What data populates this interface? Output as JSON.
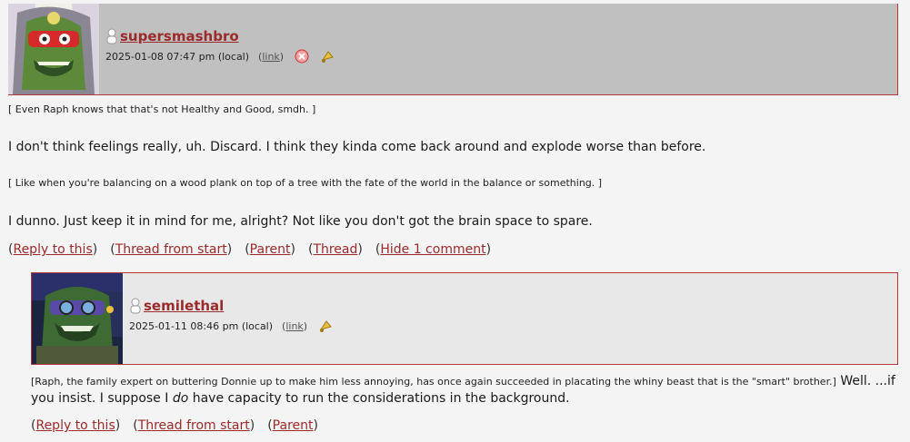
{
  "comments": [
    {
      "username": "supersmashbro",
      "date": "2025-01-08 07:47 pm (local)",
      "link_label": "link",
      "para1": "[ Even Raph knows that that's not Healthy and Good, smdh. ]",
      "para2": "I don't think feelings really, uh. Discard. I think they kinda come back around and explode worse than before.",
      "para3": "[ Like when you're balancing on a wood plank on top of a tree with the fate of the world in the balance or something. ]",
      "para4": "I dunno. Just keep it in mind for me, alright? Not like you don't got the brain space to spare.",
      "actions": [
        "Reply to this",
        "Thread from start",
        "Parent",
        "Thread",
        "Hide 1 comment"
      ]
    },
    {
      "username": "semilethal",
      "date": "2025-01-11 08:46 pm (local)",
      "link_label": "link",
      "para1_small": "[Raph, the family expert on buttering Donnie up to make him less annoying, has once again succeeded in placating the whiny beast that is the \"smart\" brother.]",
      "para1_big": " Well. ...if",
      "para2_pre": "you insist. I suppose I ",
      "para2_em": "do",
      "para2_post": " have capacity to run the considerations in the background.",
      "actions": [
        "Reply to this",
        "Thread from start",
        "Parent"
      ]
    }
  ],
  "icons": {
    "user": "user-icon",
    "delete": "delete-icon",
    "track": "track-icon"
  },
  "colors": {
    "link": "#9b2a2a",
    "header_bg_1": "#c0c0c0",
    "header_bg_2": "#e8e8e8",
    "border": "#b33a3a"
  }
}
